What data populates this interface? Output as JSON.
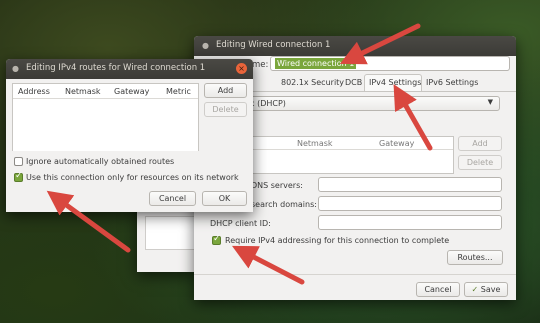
{
  "wired_window": {
    "title": "Editing Wired connection 1",
    "name_label": "me:",
    "name_value": "Wired connection 1",
    "tabs": [
      "ernet",
      "802.1x Security",
      "DCB",
      "IPv4 Settings",
      "IPv6 Settings"
    ],
    "active_tab": "IPv4 Settings",
    "method_value": "utomatic (DHCP)",
    "table_headers": [
      "Netmask",
      "Gateway"
    ],
    "add_label": "Add",
    "delete_label": "Delete",
    "dns_label": "DNS servers:",
    "search_label": "search domains:",
    "dhcp_label": "DHCP client ID:",
    "require_label": "Require IPv4 addressing for this connection to complete",
    "routes_label": "Routes...",
    "cancel_label": "Cancel",
    "save_label": "Save"
  },
  "routes_window": {
    "title": "Editing IPv4 routes for Wired connection 1",
    "headers": [
      "Address",
      "Netmask",
      "Gateway",
      "Metric"
    ],
    "add_label": "Add",
    "delete_label": "Delete",
    "ignore_label": "Ignore automatically obtained routes",
    "ignore_checked": false,
    "only_label": "Use this connection only for resources on its network",
    "only_checked": true,
    "cancel_label": "Cancel",
    "ok_label": "OK"
  },
  "colors": {
    "accent": "#7aa63c",
    "titlebar": "#3c3b37",
    "arrow": "#d9473f",
    "selection_highlight": "#7aa63c"
  }
}
